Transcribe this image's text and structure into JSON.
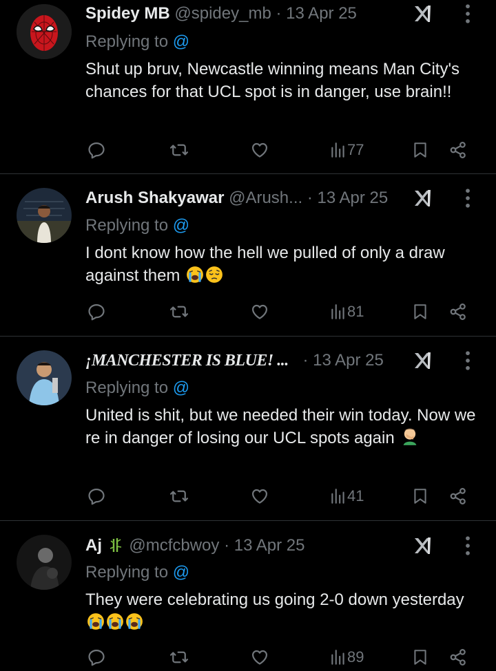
{
  "tweets": [
    {
      "name": "Spidey MB",
      "handle": "@spidey_mb",
      "sep": "·",
      "date": "13 Apr 25",
      "replying": "Replying to",
      "mention": "@",
      "text": "Shut up bruv, Newcastle winning means Man City's chances for that UCL spot is in danger, use brain!!",
      "views": "77"
    },
    {
      "name": "Arush Shakyawar",
      "handle": "@Arush...",
      "sep": "·",
      "date": "13 Apr 25",
      "replying": "Replying to",
      "mention": "@",
      "text": "I dont know how the hell we pulled of only a draw against them",
      "views": "81"
    },
    {
      "name": "¡MANCHESTER IS BLUE! ...",
      "handle": "",
      "sep": "·",
      "date": "13 Apr 25",
      "replying": "Replying to",
      "mention": "@",
      "text": "United is shit, but we needed their win today. Now we re in danger of losing our UCL spots again",
      "views": "41"
    },
    {
      "name": "Aj",
      "handle": "@mcfcbwoy",
      "sep": "·",
      "date": "13 Apr 25",
      "replying": "Replying to",
      "mention": "@",
      "text": "They were celebrating us going 2-0 down yesterday",
      "views": "89"
    }
  ],
  "icons": [
    "reply-icon",
    "repost-icon",
    "like-icon",
    "views-icon",
    "bookmark-icon",
    "share-icon",
    "grok-icon",
    "more-icon"
  ],
  "colors": {
    "background": "#000000",
    "text": "#e7e9ea",
    "muted": "#71767b",
    "link": "#1d9bf0",
    "divider": "#2f3336"
  }
}
